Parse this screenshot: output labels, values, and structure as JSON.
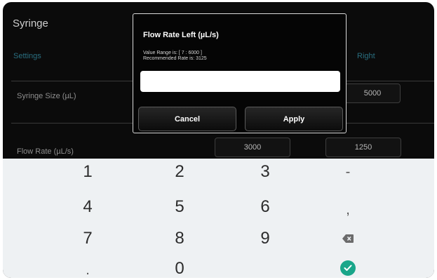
{
  "screen": {
    "title": "Syringe",
    "col_settings": "Settings",
    "col_right": "Right",
    "rows": {
      "syringe_size": {
        "label": "Syringe Size (µL)",
        "right_value": "5000"
      },
      "flow_rate": {
        "label": "Flow Rate (µL/s)",
        "left_value": "3000",
        "right_value": "1250"
      }
    }
  },
  "dialog": {
    "title": "Flow Rate Left (µL/s)",
    "range_text": "Value Range is: [ 7 : 6000 ]",
    "recommended_text": "Recommended Rate is:  3125",
    "input_value": "",
    "cancel_label": "Cancel",
    "apply_label": "Apply"
  },
  "keyboard": {
    "keys": {
      "k1": "1",
      "k2": "2",
      "k3": "3",
      "minus": "-",
      "k4": "4",
      "k5": "5",
      "k6": "6",
      "comma": ",",
      "k7": "7",
      "k8": "8",
      "k9": "9",
      "dot": ".",
      "k0": "0"
    },
    "icons": {
      "backspace": "backspace-icon",
      "done": "check-circle-icon"
    },
    "accent_color": "#1aa68a"
  }
}
